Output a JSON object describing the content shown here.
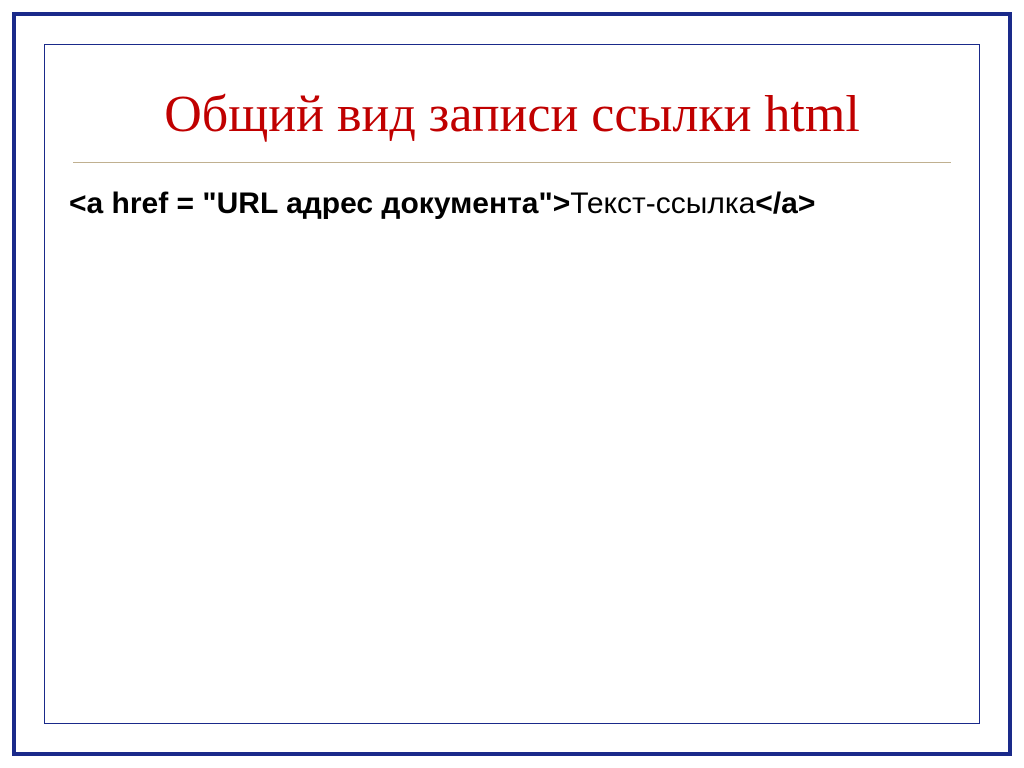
{
  "slide": {
    "title": "Общий вид записи ссылки html",
    "code": {
      "part1_bold": "<a href = \"URL адрес документа\">",
      "part2_normal": "Текст-ссылка",
      "part3_bold": "</a>"
    }
  }
}
